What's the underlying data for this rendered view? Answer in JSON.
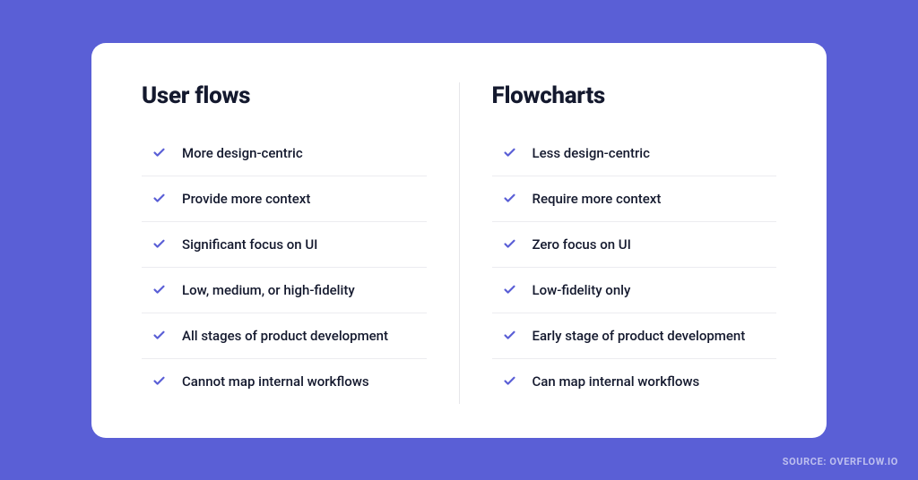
{
  "colors": {
    "background": "#5a5fd6",
    "card": "#ffffff",
    "heading": "#14192e",
    "text": "#14192e",
    "check": "#5a5fd6",
    "divider": "#ececf0"
  },
  "columns": [
    {
      "title": "User flows",
      "items": [
        "More design-centric",
        "Provide more context",
        "Significant focus on UI",
        "Low, medium, or high-fidelity",
        "All stages of product development",
        "Cannot map internal workflows"
      ]
    },
    {
      "title": "Flowcharts",
      "items": [
        "Less design-centric",
        "Require more context",
        "Zero focus on UI",
        "Low-fidelity only",
        "Early stage of product development",
        "Can map internal workflows"
      ]
    }
  ],
  "source": "SOURCE: OVERFLOW.IO"
}
